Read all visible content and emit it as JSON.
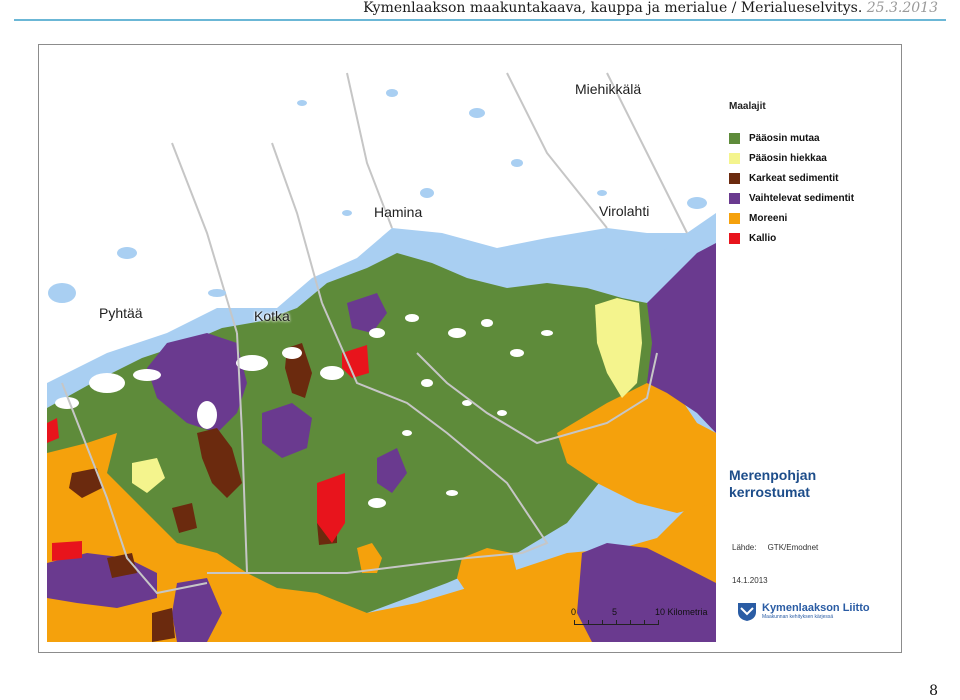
{
  "header": {
    "title": "Kymenlaakson maakuntakaava, kauppa ja merialue / Merialueselvitys.",
    "date": "25.3.2013"
  },
  "map": {
    "place_labels": [
      {
        "name": "Miehikkälä"
      },
      {
        "name": "Hamina"
      },
      {
        "name": "Virolahti"
      },
      {
        "name": "Pyhtää"
      },
      {
        "name": "Kotka"
      }
    ]
  },
  "legend": {
    "title": "Maalajit",
    "items": [
      {
        "label": "Pääosin mutaa",
        "color": "#5e8b3a"
      },
      {
        "label": "Pääosin hiekkaa",
        "color": "#f4f48d"
      },
      {
        "label": "Karkeat sedimentit",
        "color": "#6b2a0e"
      },
      {
        "label": "Vaihtelevat sedimentit",
        "color": "#6a3a8f"
      },
      {
        "label": "Moreeni",
        "color": "#f5a10c"
      },
      {
        "label": "Kallio",
        "color": "#e8141c"
      }
    ]
  },
  "map_title": {
    "line1": "Merenpohjan",
    "line2": "kerrostumat"
  },
  "source": "Lähde:     GTK/Emodnet",
  "map_date": "14.1.2013",
  "scale_bar": {
    "labels": [
      "0",
      "5",
      "10 Kilometria"
    ]
  },
  "logo": {
    "name": "Kymenlaakson Liitto",
    "tagline": "Maakunnan kehityksen kärjessä"
  },
  "page_number": "8"
}
